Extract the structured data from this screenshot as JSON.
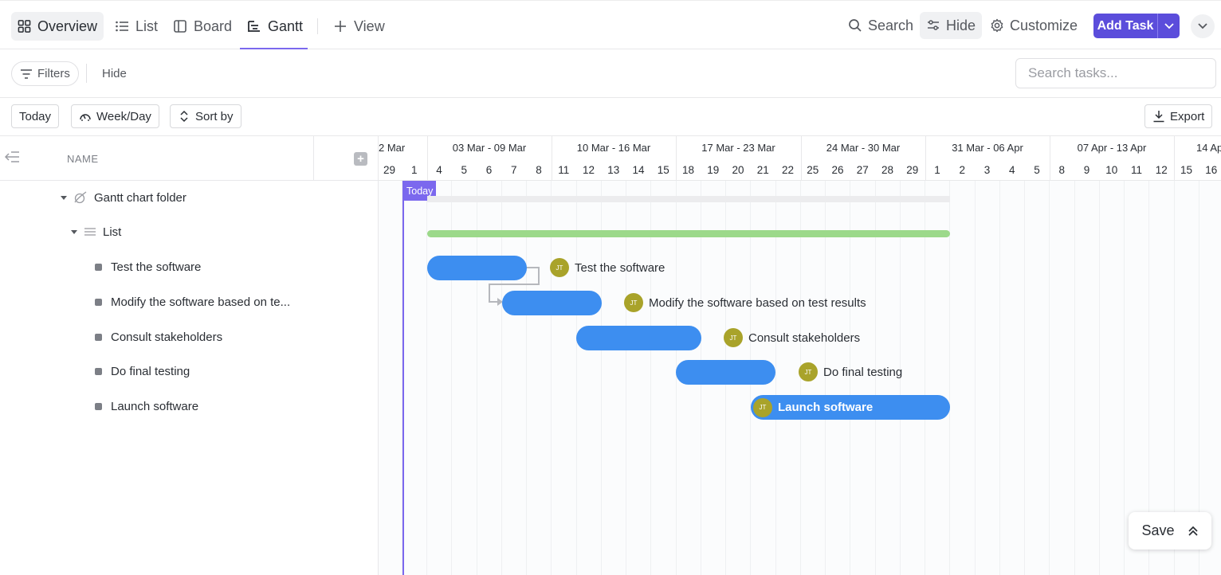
{
  "nav": {
    "tabs": [
      {
        "label": "Overview",
        "icon": "overview-grid-icon"
      },
      {
        "label": "List",
        "icon": "list-icon"
      },
      {
        "label": "Board",
        "icon": "board-icon"
      },
      {
        "label": "Gantt",
        "icon": "gantt-icon",
        "active": true
      },
      {
        "label": "View",
        "icon": "plus-icon"
      }
    ],
    "search_label": "Search",
    "hide_label": "Hide",
    "customize_label": "Customize",
    "add_task_label": "Add Task"
  },
  "toolbar": {
    "filters_label": "Filters",
    "hide_label": "Hide",
    "search_placeholder": "Search tasks..."
  },
  "gantt_toolbar": {
    "today_label": "Today",
    "scale_label": "Week/Day",
    "sort_label": "Sort by",
    "export_label": "Export"
  },
  "left_panel": {
    "name_header": "NAME",
    "folder_name": "Gantt chart folder",
    "list_name": "List",
    "tasks": [
      "Test the software",
      "Modify the software based on te...",
      "Consult stakeholders",
      "Do final testing",
      "Launch software"
    ]
  },
  "timeline": {
    "weeks": [
      "2 Mar",
      "03 Mar - 09 Mar",
      "10 Mar - 16 Mar",
      "17 Mar - 23 Mar",
      "24 Mar - 30 Mar",
      "31 Mar - 06 Apr",
      "07 Apr - 13 Apr",
      "14 Ap"
    ],
    "days": [
      "29",
      "1",
      "4",
      "5",
      "6",
      "7",
      "8",
      "11",
      "12",
      "13",
      "14",
      "15",
      "18",
      "19",
      "20",
      "21",
      "22",
      "25",
      "26",
      "27",
      "28",
      "29",
      "1",
      "2",
      "3",
      "4",
      "5",
      "8",
      "9",
      "10",
      "11",
      "12",
      "15",
      "16"
    ],
    "today_label": "Today",
    "bars": [
      {
        "label": "Test the software",
        "assignee": "JT"
      },
      {
        "label": "Modify the software based on test results",
        "assignee": "JT"
      },
      {
        "label": "Consult stakeholders",
        "assignee": "JT"
      },
      {
        "label": "Do final testing",
        "assignee": "JT"
      },
      {
        "label": "Launch software",
        "assignee": "JT"
      }
    ]
  },
  "save_label": "Save",
  "colors": {
    "accent": "#7b68ee",
    "add_task": "#5b4ddb",
    "task_bar": "#3d8ef0",
    "list_bar": "#9cd98a",
    "avatar": "#a9a32a"
  }
}
